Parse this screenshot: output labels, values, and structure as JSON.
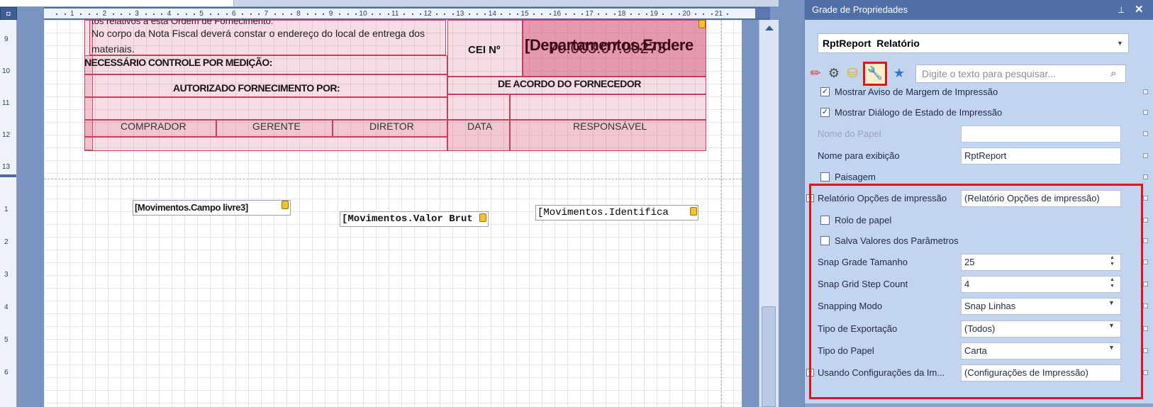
{
  "app": {
    "panel_title": "Grade de Propriedades"
  },
  "ruler": {
    "h_numbers": [
      "1",
      "2",
      "3",
      "4",
      "5",
      "6",
      "7",
      "8",
      "9",
      "10",
      "11",
      "12",
      "13",
      "14",
      "15",
      "16",
      "17",
      "18",
      "19",
      "20",
      "21"
    ],
    "v_numbers_top": [
      "9",
      "10",
      "11",
      "12",
      "13"
    ],
    "v_numbers_bottom": [
      "1",
      "2",
      "3",
      "4",
      "5",
      "6"
    ],
    "corner_symbol": "◘"
  },
  "report": {
    "line_clipped": "tos relativos à esta Ordem de Fornecimento.",
    "line_endereco": "No corpo da Nota Fiscal deverá constar o endereço do local de entrega dos",
    "line_materiais": "materiais.",
    "cei_label": "CEI Nº",
    "cei_overlay_1": "[Departamentos.Endere",
    "cei_overlay_2": "70.003.07.00273",
    "controle": "NECESSÁRIO CONTROLE POR MEDIÇÃO:",
    "autorizado": "AUTORIZADO FORNECIMENTO POR:",
    "de_acordo": "DE ACORDO DO FORNECEDOR",
    "comprador": "COMPRADOR",
    "gerente": "GERENTE",
    "diretor": "DIRETOR",
    "data": "DATA",
    "responsavel": "RESPONSÁVEL",
    "field_campo_livre": "[Movimentos.Campo livre3]",
    "field_valor_bruto": "[Movimentos.Valor Brut",
    "field_identifica": "[Movimentos.Identifica"
  },
  "panel": {
    "pin_icon": "⊥",
    "close_icon": "✕",
    "selector_object": "RptReport",
    "selector_type": "Relatório",
    "search_placeholder": "Digite o texto para pesquisar...",
    "toolbar_icons": [
      "pencil-icon",
      "gear-icon",
      "database-icon",
      "wrench-icon",
      "star-icon"
    ],
    "properties": [
      {
        "label": "Mostrar Aviso de Margem de Impressão",
        "kind": "checkbox",
        "checked": true
      },
      {
        "label": "Mostrar Diálogo de Estado de Impressão",
        "kind": "checkbox",
        "checked": true
      },
      {
        "label": "Nome do Papel",
        "kind": "text",
        "value": "",
        "disabled": true
      },
      {
        "label": "Nome para exibição",
        "kind": "text",
        "value": "RptReport"
      },
      {
        "label": "Paisagem",
        "kind": "checkbox",
        "checked": false
      },
      {
        "label": "Relatório Opções de impressão",
        "kind": "expand",
        "value": "(Relatório Opções de impressão)"
      },
      {
        "label": "Rolo de papel",
        "kind": "checkbox",
        "checked": false
      },
      {
        "label": "Salva Valores dos Parâmetros",
        "kind": "checkbox",
        "checked": false
      },
      {
        "label": "Snap Grade Tamanho",
        "kind": "spin",
        "value": "25"
      },
      {
        "label": "Snap Grid Step Count",
        "kind": "spin",
        "value": "4"
      },
      {
        "label": "Snapping Modo",
        "kind": "dropdown",
        "value": "Snap Linhas"
      },
      {
        "label": "Tipo de Exportação",
        "kind": "dropdown",
        "value": "(Todos)"
      },
      {
        "label": "Tipo do Papel",
        "kind": "dropdown",
        "value": "Carta"
      },
      {
        "label": "Usando Configurações da Im...",
        "kind": "expand",
        "value": "(Configurações de Impressão)"
      }
    ]
  },
  "colors": {
    "highlight": "#e01616",
    "panel_title_bg": "#4f6fa6",
    "report_band": "#d0466a"
  }
}
